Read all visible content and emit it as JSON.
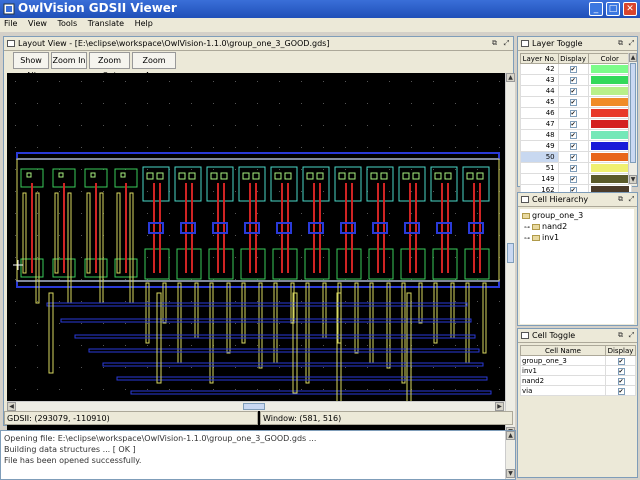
{
  "window": {
    "title": "OwlVision GDSII Viewer",
    "minimize": "_",
    "maximize": "□",
    "close": "✕"
  },
  "menu": [
    "File",
    "View",
    "Tools",
    "Translate",
    "Help"
  ],
  "layout_view": {
    "title": "Layout View - [E:\\eclipse\\workspace\\OwlVision-1.1.0\\group_one_3_GOOD.gds]",
    "buttons": {
      "show_all": "Show All",
      "zoom_in": "Zoom In",
      "zoom_out": "Zoom Out",
      "zoom_area": "Zoom Area"
    },
    "status_gdsii": "GDSII: (293079, -110910)",
    "status_window": "Window: (581, 516)"
  },
  "layer_toggle": {
    "title": "Layer Toggle",
    "headers": {
      "layer": "Layer No.",
      "display": "Display",
      "color": "Color"
    },
    "rows": [
      {
        "layer": "42",
        "checked": true,
        "color": "#7cfc8a"
      },
      {
        "layer": "43",
        "checked": true,
        "color": "#33d95a"
      },
      {
        "layer": "44",
        "checked": true,
        "color": "#b8f08a"
      },
      {
        "layer": "45",
        "checked": true,
        "color": "#f08c28"
      },
      {
        "layer": "46",
        "checked": true,
        "color": "#e83a2a"
      },
      {
        "layer": "47",
        "checked": true,
        "color": "#d42020"
      },
      {
        "layer": "48",
        "checked": true,
        "color": "#74e8b8"
      },
      {
        "layer": "49",
        "checked": true,
        "color": "#1a1ad8"
      },
      {
        "layer": "50",
        "checked": true,
        "color": "#e8661a",
        "selected": true
      },
      {
        "layer": "51",
        "checked": true,
        "color": "#f0f070"
      },
      {
        "layer": "149",
        "checked": true,
        "color": "#5a5a2a"
      },
      {
        "layer": "162",
        "checked": true,
        "color": "#4a3a2a"
      }
    ]
  },
  "cell_hierarchy": {
    "title": "Cell Hierarchy",
    "root": "group_one_3",
    "children": [
      "nand2",
      "inv1"
    ]
  },
  "cell_toggle": {
    "title": "Cell Toggle",
    "headers": {
      "name": "Cell Name",
      "display": "Display"
    },
    "rows": [
      {
        "name": "group_one_3",
        "checked": true
      },
      {
        "name": "inv1",
        "checked": true
      },
      {
        "name": "nand2",
        "checked": true
      },
      {
        "name": "via",
        "checked": true
      }
    ]
  },
  "console": [
    "Opening file: E:\\eclipse\\workspace\\OwlVision-1.1.0\\group_one_3_GOOD.gds ...",
    "Building data structures ... [ OK ]",
    "File has been opened successfully."
  ],
  "icons": {
    "window": "owl-app-icon",
    "check": "✔"
  }
}
